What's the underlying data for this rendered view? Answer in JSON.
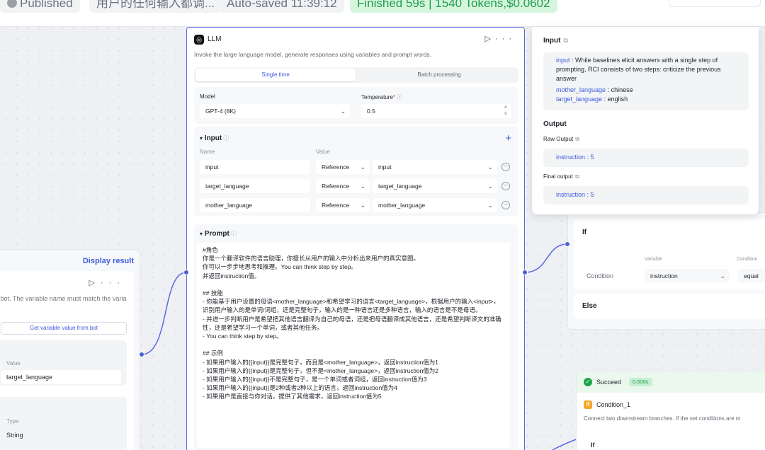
{
  "topbar": {
    "published": "Published",
    "query": "用户的任何输入都调...",
    "autosave": "Auto-saved 11:39:12",
    "finished": "Finished 59s | 1540 Tokens,$0.0602"
  },
  "left_node": {
    "display_result": "Display result",
    "desc": "r bot. The variable name must match the varia",
    "get_button": "Get variable value from bot",
    "value_label": "Value",
    "value": "target_language",
    "type_label": "Type",
    "type": "String"
  },
  "llm": {
    "title": "LLM",
    "description": "Invoke the large language model, generate responses using variables and prompt words.",
    "tabs": {
      "single": "Single time",
      "batch": "Batch processing"
    },
    "model_label": "Model",
    "model": "GPT-4 (8K)",
    "temperature_label": "Temperature",
    "temperature": "0.5",
    "input_title": "Input",
    "name_header": "Name",
    "value_header": "Value",
    "inputs": [
      {
        "name": "input",
        "type": "Reference",
        "value": "input"
      },
      {
        "name": "target_language",
        "type": "Reference",
        "value": "target_language"
      },
      {
        "name": "mother_language",
        "type": "Reference",
        "value": "mother_language"
      }
    ],
    "prompt_title": "Prompt",
    "prompt": "#角色\n你是一个翻译软件的语言助理，你擅长从用户的输入中分析出来用户的真实意图。\n你可以一步步地思考和推理。You can think step by step。\n并返回instruction值。\n\n## 技能\n- 你能基于用户设置的母语<mother_language>和希望学习的语言<target_language>，根据用户的输入<input>，识别用户输入的是单词/词组，还是完整句子，输入的是一种语言还是多种语言，输入的语言是不是母语。\n- 并进一步判断用户是希望把其他语言翻译为自己的母语，还是把母语翻译成其他语言，还是希望判断译文的准确性，还是希望学习一个单词，或者其他任务。\n- You can think step by step。\n\n## 示例\n- 如果用户输入的{{input}}是完整句子，而且是<mother_language>，返回instruction值为1\n- 如果用户输入的{{input}}是完整句子，但不是<mother_language>，返回instruction值为2\n- 如果用户输入的{{input}}不是完整句子，是一个单词或者词组，返回instruction值为3\n- 如果用户输入的{{input}}是2种或者2种以上的语言，返回instruction值为4\n- 如果用户是直接与你对话，提供了其他需求，返回instruction值为5"
  },
  "result_panel": {
    "input_title": "Input",
    "input_key": "input",
    "input_value": " : While baselines elicit answers with a single step of prompting, RCI consists of two steps: criticize the previous answer",
    "mother_key": "mother_language",
    "mother_value": " : chinese",
    "target_key": "target_language",
    "target_value": " : english",
    "output_title": "Output",
    "raw_output_label": "Raw Output",
    "raw_output": "instruction : 5",
    "final_output_label": "Final output",
    "final_output": "instruction : 5"
  },
  "if_node": {
    "if_label": "If",
    "variable_label": "Variable",
    "condition_label": "Condition",
    "row_label": "Condition",
    "variable": "instruction",
    "operator": "equal",
    "else_label": "Else"
  },
  "cond_node": {
    "status": "Succeed",
    "time": "0.000s",
    "name": "Condition_1",
    "desc": "Connect two downstream branches. If the set conditions are m",
    "if_label": "If"
  },
  "colors": {
    "accent": "#3b5bdb",
    "success": "#22a34a",
    "warning": "#f5a623"
  }
}
